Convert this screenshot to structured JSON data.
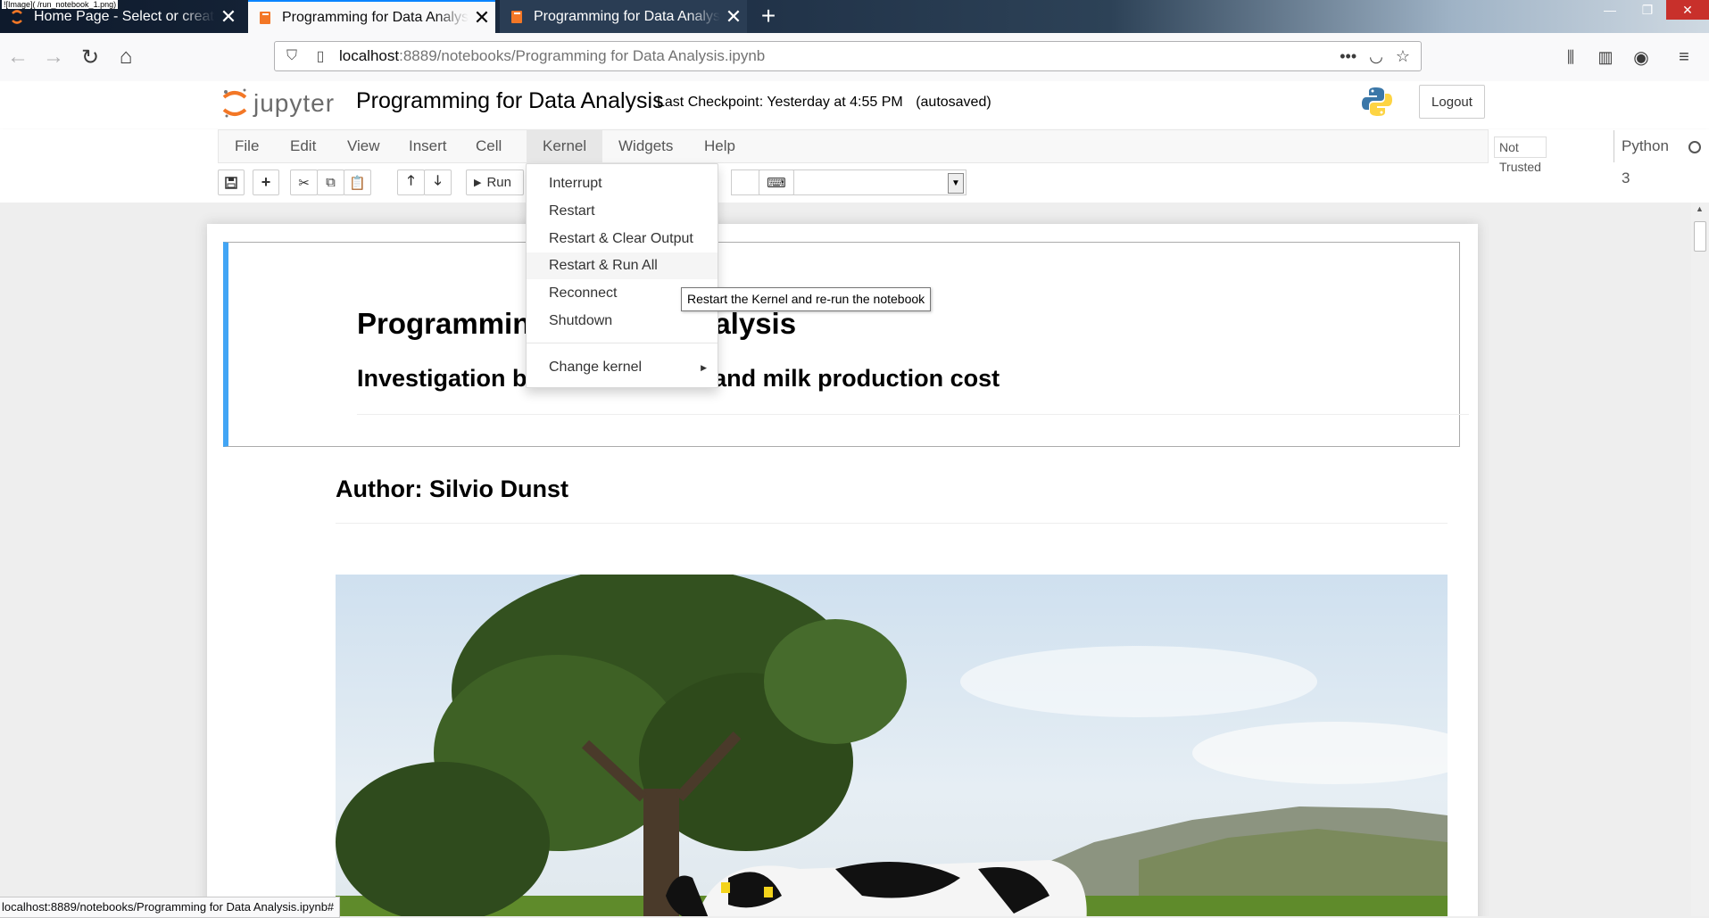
{
  "browser": {
    "caption": "![Image]( /run_notebook_1.png)",
    "tabs": [
      {
        "title": "Home Page - Select or create a notebook",
        "active": false
      },
      {
        "title": "Programming for Data Analysis",
        "active": true
      },
      {
        "title": "Programming for Data Analysis",
        "active": false
      }
    ],
    "url_host": "localhost",
    "url_path": ":8889/notebooks/Programming for Data Analysis.ipynb",
    "status_url": "localhost:8889/notebooks/Programming for Data Analysis.ipynb#",
    "accent": "#0a84ff"
  },
  "jupyter": {
    "logo_text": "jupyter",
    "notebook_title": "Programming for Data Analysis",
    "checkpoint": "Last Checkpoint: Yesterday at 4:55 PM",
    "autosave": "(autosaved)",
    "logout_label": "Logout",
    "menu": [
      "File",
      "Edit",
      "View",
      "Insert",
      "Cell",
      "Kernel",
      "Widgets",
      "Help"
    ],
    "open_menu": "Kernel",
    "trust_status": "Not Trusted",
    "kernel_name": "Python 3",
    "toolbar": {
      "run_label": "Run",
      "icons": [
        "save-icon",
        "plus-icon",
        "cut-icon",
        "copy-icon",
        "paste-icon",
        "arrow-up-icon",
        "arrow-down-icon",
        "run-icon",
        "keyboard-icon"
      ]
    },
    "kernel_menu": {
      "items": [
        "Interrupt",
        "Restart",
        "Restart & Clear Output",
        "Restart & Run All",
        "Reconnect",
        "Shutdown"
      ],
      "hovered": "Restart & Run All",
      "submenu_item": "Change kernel",
      "tooltip": "Restart the Kernel and re-run the notebook"
    },
    "cells": {
      "title_h1": "Programming for Data Analysis",
      "subtitle_h2": "Investigation between weather and milk production cost",
      "author_h2": "Author: Silvio Dunst"
    },
    "accent_cell_border": "#42a5f5"
  }
}
